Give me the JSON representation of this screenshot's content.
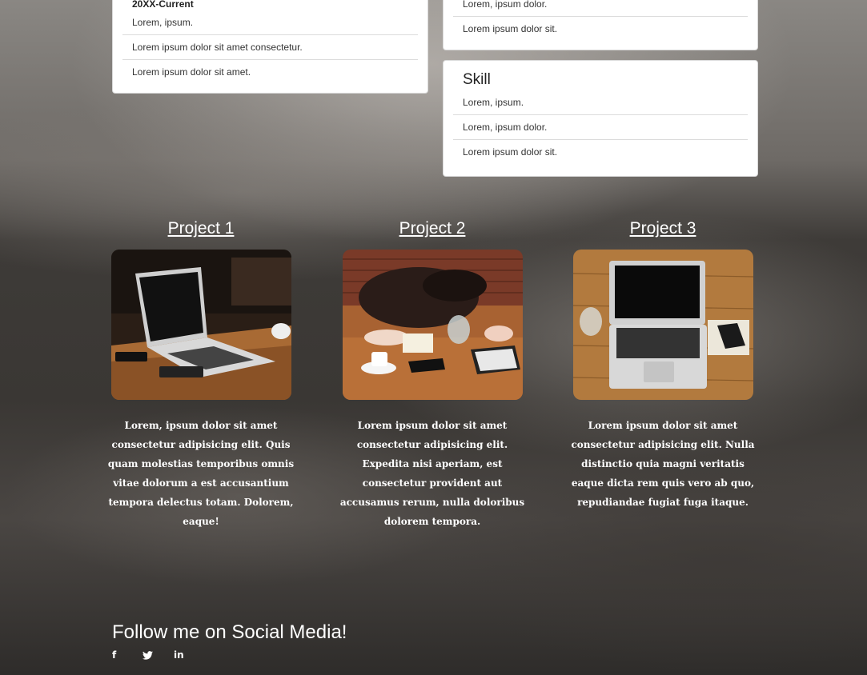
{
  "experience": {
    "period": "20XX-Current",
    "items": [
      "Lorem, ipsum.",
      "Lorem ipsum dolor sit amet consectetur.",
      "Lorem ipsum dolor sit amet."
    ]
  },
  "top_right_card": {
    "items": [
      "Lorem, ipsum dolor.",
      "Lorem ipsum dolor sit."
    ]
  },
  "skill": {
    "title": "Skill",
    "items": [
      "Lorem, ipsum.",
      "Lorem, ipsum dolor.",
      "Lorem ipsum dolor sit."
    ]
  },
  "projects": [
    {
      "title": "Project 1",
      "description": "Lorem, ipsum dolor sit amet consectetur adipisicing elit. Quis quam molestias temporibus omnis vitae dolorum a est accusantium tempora delectus totam. Dolorem, eaque!"
    },
    {
      "title": "Project 2",
      "description": "Lorem ipsum dolor sit amet consectetur adipisicing elit. Expedita nisi aperiam, est consectetur provident aut accusamus rerum, nulla doloribus dolorem tempora."
    },
    {
      "title": "Project 3",
      "description": "Lorem ipsum dolor sit amet consectetur adipisicing elit. Nulla distinctio quia magni veritatis eaque dicta rem quis vero ab quo, repudiandae fugiat fuga itaque."
    }
  ],
  "social": {
    "heading": "Follow me on Social Media!",
    "icons": [
      {
        "name": "facebook-icon",
        "glyph": "f"
      },
      {
        "name": "twitter-icon",
        "glyph": "🐦"
      },
      {
        "name": "linkedin-icon",
        "glyph": "in"
      }
    ]
  },
  "colors": {
    "card_bg": "#ffffff",
    "text_light": "#ffffff"
  }
}
